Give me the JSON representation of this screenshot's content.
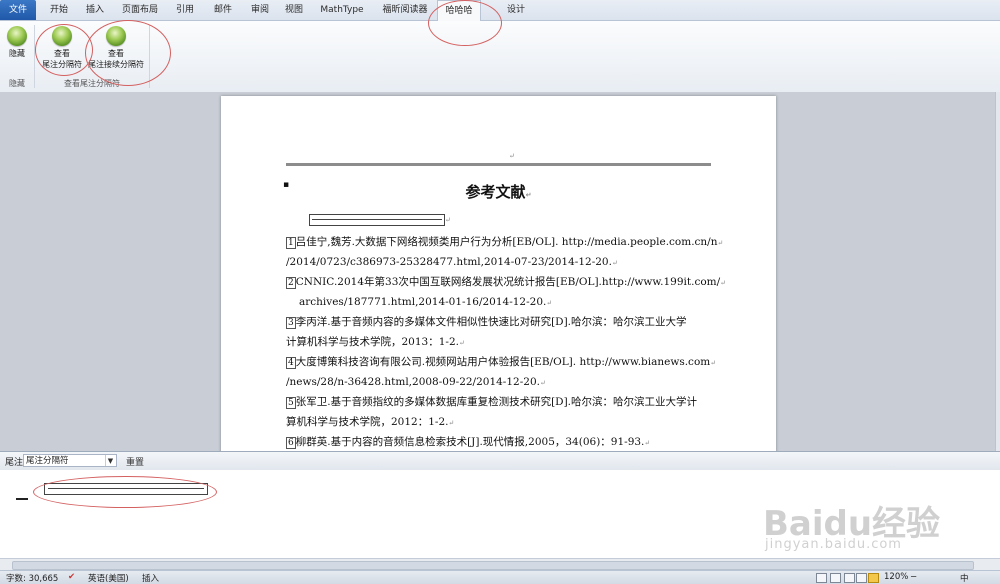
{
  "tabs": [
    "文件",
    "开始",
    "插入",
    "页面布局",
    "引用",
    "邮件",
    "审阅",
    "视图",
    "MathType",
    "福昕阅读器",
    "哈哈哈",
    "设计"
  ],
  "ribbon": {
    "hide_label": "隐藏",
    "group1_label": "隐藏",
    "view_label": "查看",
    "btn_footnote_sep": "尾注分隔符",
    "btn_footnote_cont": "尾注接续分隔符",
    "group2_label": "查看尾注分隔符"
  },
  "document": {
    "title": "参考文献",
    "references": [
      {
        "num": "1",
        "text": "吕佳宁,魏芳.大数据下网络视频类用户行为分析[EB/OL]. http://media.people.com.cn/n",
        "cont": "/2014/0723/c386973-25328477.html,2014-07-23/2014-12-20."
      },
      {
        "num": "2",
        "text": "CNNIC.2014年第33次中国互联网络发展状况统计报告[EB/OL].http://www.199it.com/",
        "cont": "archives/187771.html,2014-01-16/2014-12-20."
      },
      {
        "num": "3",
        "text": "李丙洋.基于音频内容的多媒体文件相似性快速比对研究[D].哈尔滨：哈尔滨工业大学",
        "cont": "计算机科学与技术学院，2013：1-2."
      },
      {
        "num": "4",
        "text": "大度博策科技咨询有限公司.视频网站用户体验报告[EB/OL]. http://www.bianews.com",
        "cont": "/news/28/n-36428.html,2008-09-22/2014-12-20."
      },
      {
        "num": "5",
        "text": "张军卫.基于音频指纹的多媒体数据库重复检测技术研究[D].哈尔滨：哈尔滨工业大学计",
        "cont": "算机科学与技术学院，2012：1-2."
      },
      {
        "num": "6",
        "text": "柳群英.基于内容的音频信息检索技术[J].现代情报,2005，34(06)：91-93.",
        "cont": ""
      }
    ]
  },
  "footnote_pane": {
    "label": "尾注",
    "select_value": "尾注分隔符",
    "reset_label": "重置"
  },
  "status": {
    "word_count": "字数: 30,665",
    "language": "英语(美国)",
    "mode": "插入",
    "zoom": "120%",
    "ime": "中"
  },
  "watermark": {
    "main": "Baidu经验",
    "sub": "jingyan.baidu.com"
  }
}
